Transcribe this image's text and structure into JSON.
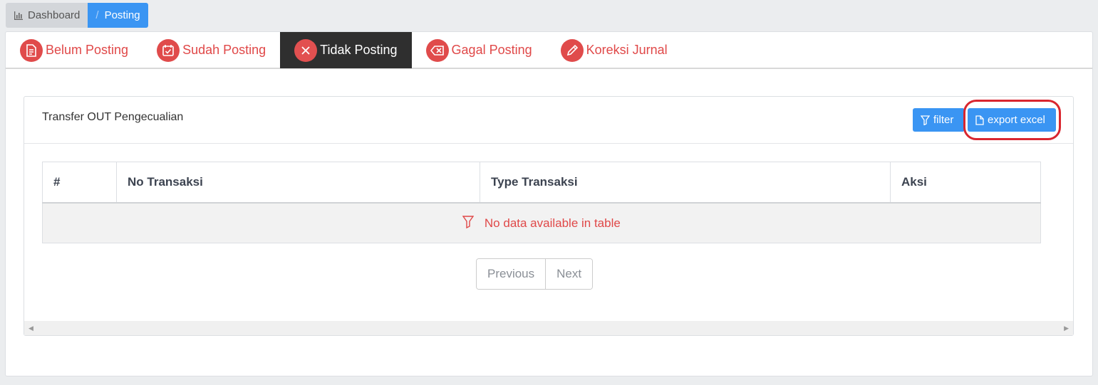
{
  "breadcrumb": {
    "dashboard": "Dashboard",
    "separator": "/",
    "current": "Posting"
  },
  "tabs": [
    {
      "label": "Belum Posting",
      "icon": "document-icon"
    },
    {
      "label": "Sudah Posting",
      "icon": "calendar-check-icon"
    },
    {
      "label": "Tidak Posting",
      "icon": "close-icon"
    },
    {
      "label": "Gagal Posting",
      "icon": "backspace-icon"
    },
    {
      "label": "Koreksi Jurnal",
      "icon": "pencil-icon"
    }
  ],
  "active_tab": "Tidak Posting",
  "panel": {
    "title": "Transfer OUT Pengecualian",
    "filter_label": "filter",
    "export_label": "export excel"
  },
  "table": {
    "columns": [
      "#",
      "No Transaksi",
      "Type Transaksi",
      "Aksi"
    ],
    "empty_message": "No data available in table"
  },
  "pagination": {
    "previous": "Previous",
    "next": "Next"
  },
  "colors": {
    "accent": "#3a95f3",
    "tab_text": "#e04848",
    "active_tab_bg": "#2f2f2f",
    "highlight": "#d9262f"
  }
}
